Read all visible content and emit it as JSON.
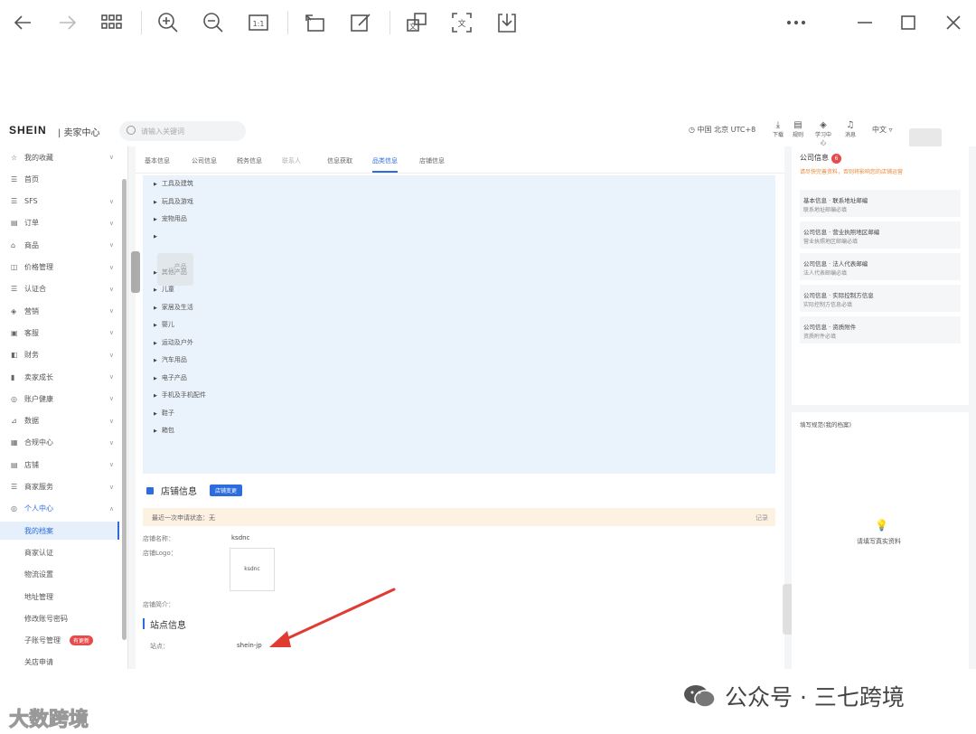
{
  "viewer": {
    "buttons": [
      "back-icon",
      "forward-icon",
      "grid-icon",
      "zoom-in-icon",
      "zoom-out-icon",
      "actual-size-icon",
      "rotate-icon",
      "edit-icon",
      "translate-icon",
      "ocr-icon",
      "download-icon",
      "more-icon",
      "minimize-icon",
      "maximize-icon",
      "close-icon"
    ],
    "actual_size_label": "1:1"
  },
  "header": {
    "logo": "SHEIN",
    "logo_sub": "| 卖家中心",
    "search_placeholder": "请输入关键词",
    "timezone": "中国 北京 UTC+8",
    "icons": [
      {
        "glyph": "⤓",
        "label": "下载"
      },
      {
        "glyph": "▤",
        "label": "规则"
      },
      {
        "glyph": "◈",
        "label": "学习中心"
      },
      {
        "glyph": "♫",
        "label": "消息"
      }
    ],
    "language": "中文 ▿"
  },
  "sidebar": {
    "items": [
      {
        "icon": "☆",
        "label": "我的收藏",
        "chev": "∨"
      },
      {
        "icon": "☰",
        "label": "首页",
        "chev": ""
      },
      {
        "icon": "☰",
        "label": "SFS",
        "chev": "∨"
      },
      {
        "icon": "▤",
        "label": "订单",
        "chev": "∨"
      },
      {
        "icon": "⌂",
        "label": "商品",
        "chev": "∨"
      },
      {
        "icon": "◫",
        "label": "价格管理",
        "chev": "∨"
      },
      {
        "icon": "☰",
        "label": "认证合",
        "chev": "∨"
      },
      {
        "icon": "◈",
        "label": "营销",
        "chev": "∨"
      },
      {
        "icon": "▣",
        "label": "客服",
        "chev": "∨"
      },
      {
        "icon": "◧",
        "label": "财务",
        "chev": "∨"
      },
      {
        "icon": "▮",
        "label": "卖家成长",
        "chev": "∨"
      },
      {
        "icon": "◎",
        "label": "账户健康",
        "chev": "∨"
      },
      {
        "icon": "⊿",
        "label": "数据",
        "chev": "∨"
      },
      {
        "icon": "▦",
        "label": "合规中心",
        "chev": "∨"
      },
      {
        "icon": "▤",
        "label": "店铺",
        "chev": "∨"
      },
      {
        "icon": "☰",
        "label": "商家服务",
        "chev": "∨"
      },
      {
        "icon": "◎",
        "label": "个人中心",
        "chev": "∧"
      }
    ],
    "sub_items": [
      {
        "label": "我的档案"
      },
      {
        "label": "商家认证"
      },
      {
        "label": "物流设置"
      },
      {
        "label": "地址管理"
      },
      {
        "label": "修改账号密码"
      },
      {
        "label": "子账号管理",
        "badge": "有更新"
      },
      {
        "label": "关店申请"
      }
    ]
  },
  "main": {
    "tabs": [
      "基本信息",
      "公司信息",
      "税务信息",
      "联系人",
      "信息获取",
      "品类信息",
      "店铺信息"
    ],
    "active_tab": 5,
    "tree_items": [
      "工具及建筑",
      "玩具及游戏",
      "宠物用品",
      "",
      "",
      "其他产品",
      "儿童",
      "家居及生活",
      "婴儿",
      "运动及户外",
      "汽车用品",
      "电子产品",
      "手机及手机配件",
      "鞋子",
      "箱包"
    ],
    "tree_partial": "...产品",
    "store_section": {
      "title": "店铺信息",
      "button": "店铺变更",
      "notice": "最近一次申请状态：无",
      "notice_right": "记录",
      "name_label": "店铺名称：",
      "name_value": "ksdnc",
      "logo_label": "店铺Logo：",
      "logo_text": "ksdnc",
      "intro_label": "店铺简介："
    },
    "site_section": {
      "title": "站点信息",
      "site_label": "站点：",
      "site_value": "shein-jp"
    }
  },
  "right_panel": {
    "company_title": "公司信息",
    "company_count": "6",
    "warning": "请尽快完善资料，否则将影响您的店铺运营",
    "rows": [
      {
        "title": "基本信息 · 联系地址邮编",
        "sub": "联系地址邮编必填"
      },
      {
        "title": "公司信息 · 营业执照地区邮编",
        "sub": "营业执照地区邮编必填"
      },
      {
        "title": "公司信息 · 法人代表邮编",
        "sub": "法人代表邮编必填"
      },
      {
        "title": "公司信息 · 实际控制方信息",
        "sub": "实际控制方信息必填"
      },
      {
        "title": "公司信息 · 资质附件",
        "sub": "资质附件必填"
      }
    ],
    "guide_title": "填写规范(我的档案)",
    "guide_hint": "请填写真实资料"
  },
  "watermarks": {
    "wechat_text": "公众号 · 三七跨境",
    "bottom_left": "大数跨境"
  },
  "colors": {
    "accent": "#2d6cdf",
    "badge": "#e84a4a",
    "arrow": "#e03a32"
  }
}
